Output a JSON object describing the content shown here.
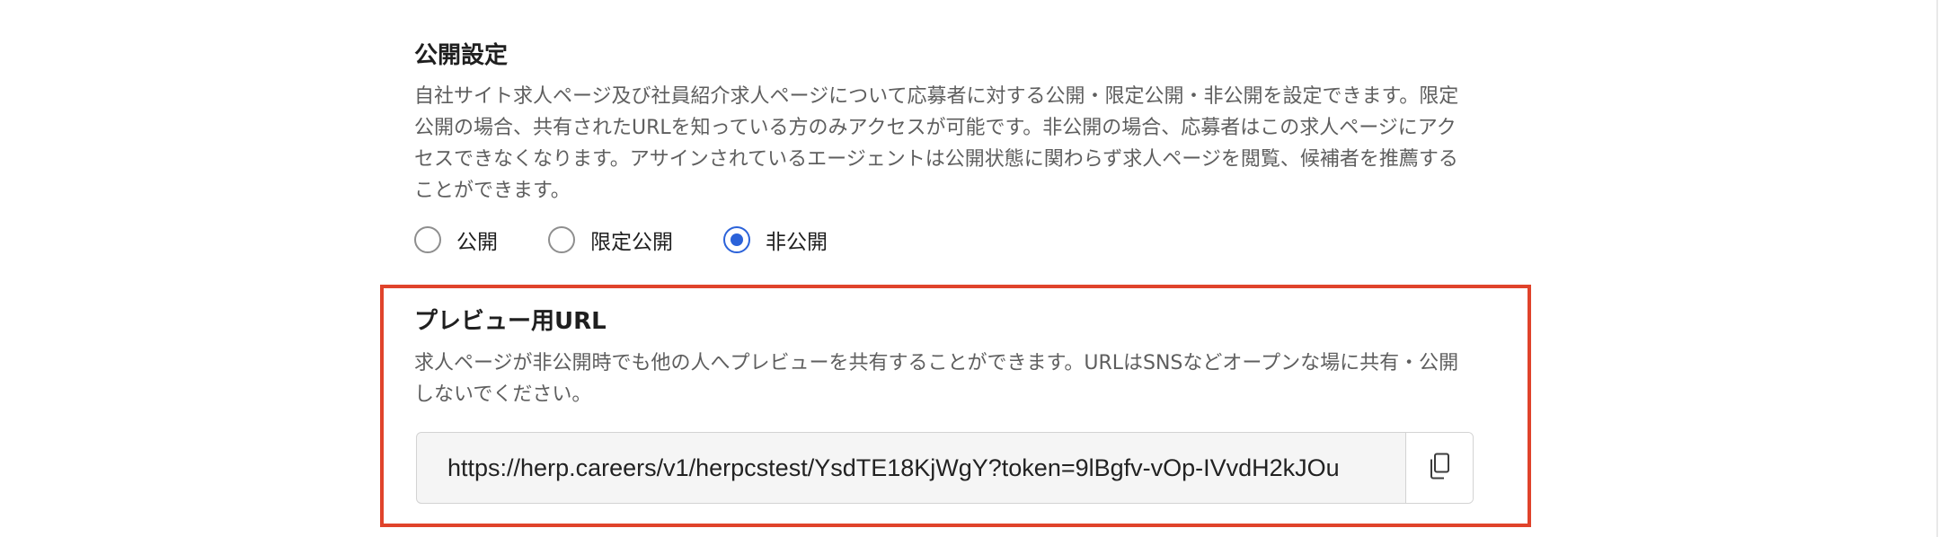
{
  "visibility": {
    "title": "公開設定",
    "description": "自社サイト求人ページ及び社員紹介求人ページについて応募者に対する公開・限定公開・非公開を設定できます。限定公開の場合、共有されたURLを知っている方のみアクセスが可能です。非公開の場合、応募者はこの求人ページにアクセスできなくなります。アサインされているエージェントは公開状態に関わらず求人ページを閲覧、候補者を推薦することができます。",
    "options": [
      {
        "label": "公開",
        "checked": false
      },
      {
        "label": "限定公開",
        "checked": false
      },
      {
        "label": "非公開",
        "checked": true
      }
    ]
  },
  "preview": {
    "title": "プレビュー用URL",
    "description": "求人ページが非公開時でも他の人へプレビューを共有することができます。URLはSNSなどオープンな場に共有・公開しないでください。",
    "url": "https://herp.careers/v1/herpcstest/YsdTE18KjWgY?token=9lBgfv-vOp-IVvdH2kJOu",
    "copy_icon": "copy-icon"
  },
  "colors": {
    "accent": "#2b62d9",
    "highlight": "#e0432b"
  }
}
